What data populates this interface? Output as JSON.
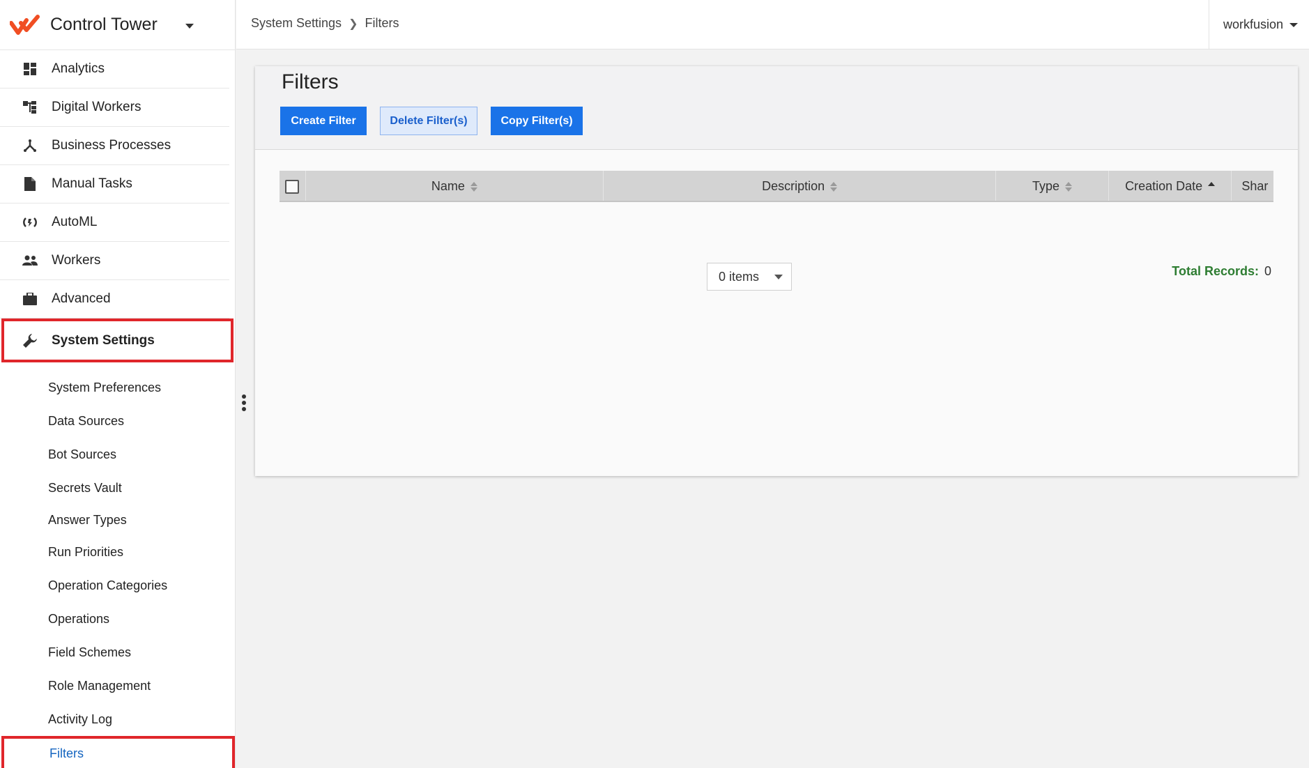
{
  "app": {
    "title": "Control Tower"
  },
  "sidebar": {
    "items": [
      {
        "label": "Analytics",
        "icon": "dashboard-icon"
      },
      {
        "label": "Digital Workers",
        "icon": "hierarchy-icon"
      },
      {
        "label": "Business Processes",
        "icon": "process-icon"
      },
      {
        "label": "Manual Tasks",
        "icon": "document-icon"
      },
      {
        "label": "AutoML",
        "icon": "brain-icon"
      },
      {
        "label": "Workers",
        "icon": "people-icon"
      },
      {
        "label": "Advanced",
        "icon": "briefcase-icon"
      },
      {
        "label": "System Settings",
        "icon": "wrench-icon",
        "active": true
      }
    ],
    "sub_items": [
      {
        "label": "System Preferences"
      },
      {
        "label": "Data Sources"
      },
      {
        "label": "Bot Sources"
      },
      {
        "label": "Secrets Vault"
      },
      {
        "label": "Answer Types"
      },
      {
        "label": "Run Priorities"
      },
      {
        "label": "Operation Categories"
      },
      {
        "label": "Operations"
      },
      {
        "label": "Field Schemes"
      },
      {
        "label": "Role Management"
      },
      {
        "label": "Activity Log"
      },
      {
        "label": "Filters",
        "current": true
      }
    ]
  },
  "header": {
    "breadcrumb": [
      "System Settings",
      "Filters"
    ],
    "user": "workfusion"
  },
  "main": {
    "title": "Filters",
    "buttons": {
      "create": "Create Filter",
      "delete": "Delete Filter(s)",
      "copy": "Copy Filter(s)"
    },
    "columns": [
      {
        "label": "Name",
        "sort": "none"
      },
      {
        "label": "Description",
        "sort": "none"
      },
      {
        "label": "Type",
        "sort": "none"
      },
      {
        "label": "Creation Date",
        "sort": "asc"
      },
      {
        "label": "Shar"
      }
    ],
    "pager": {
      "value": "0 items"
    },
    "total": {
      "label": "Total Records:",
      "value": "0"
    }
  },
  "colors": {
    "primary": "#1a73e8",
    "highlight": "#e0262b",
    "active_link": "#1565c0",
    "total_label": "#2e7d32",
    "brand": "#f04e23"
  }
}
